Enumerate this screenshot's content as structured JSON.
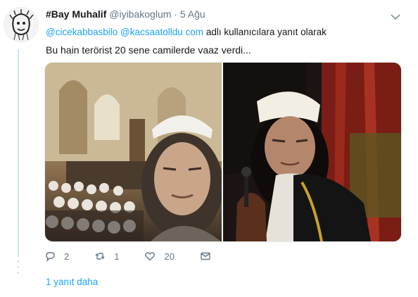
{
  "tweet": {
    "author_name": "#Bay Muhalif",
    "author_handle": "@iyibakoglum",
    "separator": "·",
    "date": "5 Ağu",
    "reply_mention_1": "@cicekabbasbilo",
    "reply_mention_2": "@kacsaatolldu com",
    "reply_suffix": "adlı kullanıcılara yanıt olarak",
    "text": "Bu hain terörist 20 sene camilerde vaaz verdi...",
    "reply_count": "2",
    "retweet_count": "1",
    "like_count": "20"
  },
  "thread": {
    "more_replies_label": "1 yanıt daha"
  },
  "colors": {
    "accent": "#1da1f2",
    "muted": "#657786",
    "thread_line": "#cfe6f5"
  },
  "icons": [
    "chevron-down-icon",
    "reply-icon",
    "retweet-icon",
    "like-icon",
    "dm-icon"
  ]
}
